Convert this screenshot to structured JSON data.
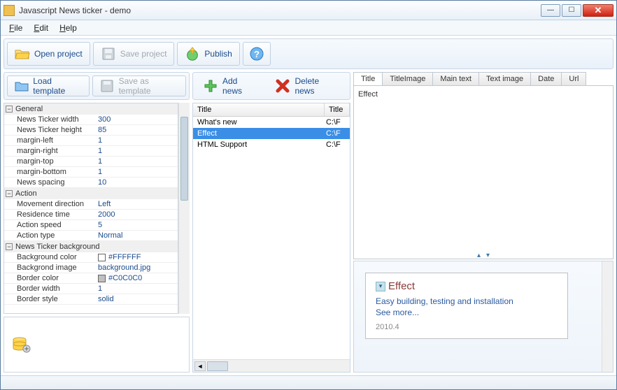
{
  "window": {
    "title": "Javascript News ticker - demo"
  },
  "menubar": {
    "file": "File",
    "edit": "Edit",
    "help": "Help"
  },
  "toolbar": {
    "open_project": "Open project",
    "save_project": "Save project",
    "publish": "Publish"
  },
  "left_toolbar": {
    "load_template": "Load template",
    "save_as_template": "Save as template"
  },
  "property_groups": [
    {
      "name": "General",
      "rows": [
        {
          "key": "News Ticker width",
          "val": "300"
        },
        {
          "key": "News Ticker height",
          "val": "85"
        },
        {
          "key": "margin-left",
          "val": "1"
        },
        {
          "key": "margin-right",
          "val": "1"
        },
        {
          "key": "margin-top",
          "val": "1"
        },
        {
          "key": "margin-bottom",
          "val": "1"
        },
        {
          "key": "News spacing",
          "val": "10"
        }
      ]
    },
    {
      "name": "Action",
      "rows": [
        {
          "key": "Movement direction",
          "val": "Left"
        },
        {
          "key": "Residence time",
          "val": "2000"
        },
        {
          "key": "Action speed",
          "val": "5"
        },
        {
          "key": "Action type",
          "val": "Normal"
        }
      ]
    },
    {
      "name": "News Ticker background",
      "rows": [
        {
          "key": "Background color",
          "val": "#FFFFFF",
          "swatch": "#FFFFFF"
        },
        {
          "key": "Backgrond image",
          "val": "background.jpg"
        },
        {
          "key": "Border color",
          "val": "#C0C0C0",
          "swatch": "#C0C0C0"
        },
        {
          "key": "Border width",
          "val": "1"
        },
        {
          "key": "Border style",
          "val": "solid"
        }
      ]
    }
  ],
  "mid_toolbar": {
    "add_news": "Add news",
    "delete_news": "Delete news"
  },
  "news_list": {
    "col_title": "Title",
    "col_titleimg": "Title",
    "rows": [
      {
        "title": "What's new",
        "img": "C:\\F",
        "selected": false
      },
      {
        "title": "Effect",
        "img": "C:\\F",
        "selected": true
      },
      {
        "title": "HTML Support",
        "img": "C:\\F",
        "selected": false
      }
    ]
  },
  "tabs": {
    "items": [
      "Title",
      "TitleImage",
      "Main text",
      "Text image",
      "Date",
      "Url"
    ],
    "active": 0,
    "content": "Effect"
  },
  "preview": {
    "title": "Effect",
    "line1": "Easy building, testing and installation",
    "line2": "See more...",
    "date": "2010.4"
  }
}
